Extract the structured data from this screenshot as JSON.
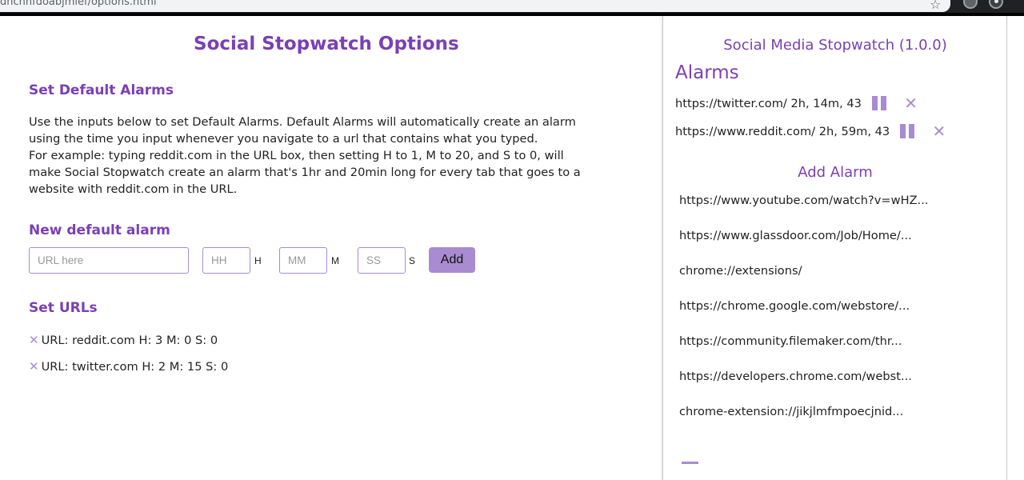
{
  "browser": {
    "url": "dhcnhfdoabjmlef/options.html"
  },
  "options": {
    "title": "Social Stopwatch Options",
    "default_alarms_heading": "Set Default Alarms",
    "description_line1": "Use the inputs below to set Default Alarms. Default Alarms will automatically create an alarm using the time you input whenever you navigate to a url that contains what you typed.",
    "description_line2": "For example: typing reddit.com in the URL box, then setting H to 1, M to 20, and S to 0, will make Social Stopwatch create an alarm that's 1hr and 20min long for every tab that goes to a website with reddit.com in the URL.",
    "new_alarm_heading": "New default alarm",
    "form": {
      "url_placeholder": "URL here",
      "hh_placeholder": "HH",
      "mm_placeholder": "MM",
      "ss_placeholder": "SS",
      "h_unit": "H",
      "m_unit": "M",
      "s_unit": "S",
      "add_label": "Add"
    },
    "set_urls_heading": "Set URLs",
    "set_urls": [
      {
        "text": "URL: reddit.com H: 3 M: 0 S: 0"
      },
      {
        "text": "URL: twitter.com H: 2 M: 15 S: 0"
      }
    ]
  },
  "popup": {
    "title": "Social Media Stopwatch (1.0.0)",
    "alarms_heading": "Alarms",
    "alarms": [
      {
        "text": "https://twitter.com/ 2h, 14m, 43"
      },
      {
        "text": "https://www.reddit.com/ 2h, 59m, 43"
      }
    ],
    "add_alarm_heading": "Add Alarm",
    "tabs": [
      "https://www.youtube.com/watch?v=wHZ...",
      "https://www.glassdoor.com/Job/Home/...",
      "chrome://extensions/",
      "https://chrome.google.com/webstore/...",
      "https://community.filemaker.com/thr...",
      "https://developers.chrome.com/webst...",
      "chrome-extension://jikjlmfmpoecjnid..."
    ]
  },
  "colors": {
    "heading_purple": "#7b3fb5",
    "accent_lavender": "#a98bd1"
  }
}
